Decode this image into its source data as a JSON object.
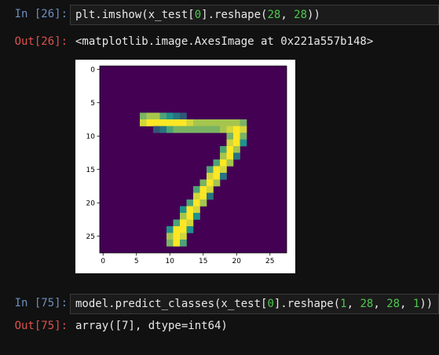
{
  "cells": [
    {
      "in_prompt": "In [26]:",
      "code": {
        "a": "plt.imshow(x_test[",
        "n1": "0",
        "b": "].reshape(",
        "n2": "28",
        "c": ", ",
        "n3": "28",
        "d": "))"
      },
      "out_prompt": "Out[26]:",
      "output": "<matplotlib.image.AxesImage at 0x221a557b148>"
    },
    {
      "in_prompt": "In [75]:",
      "code": {
        "a": "model.predict_classes(x_test[",
        "n1": "0",
        "b": "].reshape(",
        "n2": "1",
        "c": ", ",
        "n3": "28",
        "d": ", ",
        "n4": "28",
        "e": ", ",
        "n5": "1",
        "f": "))"
      },
      "out_prompt": "Out[75]:",
      "output": "array([7], dtype=int64)"
    }
  ],
  "chart_data": {
    "type": "heatmap",
    "colormap": "viridis",
    "colors": {
      "low": "#440154",
      "mid": "#21918c",
      "high": "#fde725"
    },
    "rows": 28,
    "cols": 28,
    "xticks": [
      "0",
      "5",
      "10",
      "15",
      "20",
      "25"
    ],
    "yticks": [
      "0",
      "5",
      "10",
      "15",
      "20",
      "25"
    ],
    "ink_cells": [
      [
        7,
        6,
        0.7
      ],
      [
        7,
        7,
        0.8
      ],
      [
        7,
        8,
        0.8
      ],
      [
        7,
        9,
        0.6
      ],
      [
        7,
        10,
        0.5
      ],
      [
        7,
        11,
        0.4
      ],
      [
        7,
        12,
        0.3
      ],
      [
        8,
        6,
        0.9
      ],
      [
        8,
        7,
        1
      ],
      [
        8,
        8,
        1
      ],
      [
        8,
        9,
        1
      ],
      [
        8,
        10,
        1
      ],
      [
        8,
        11,
        1
      ],
      [
        8,
        12,
        1
      ],
      [
        8,
        13,
        0.9
      ],
      [
        8,
        14,
        0.8
      ],
      [
        8,
        15,
        0.8
      ],
      [
        8,
        16,
        0.8
      ],
      [
        8,
        17,
        0.8
      ],
      [
        8,
        18,
        0.8
      ],
      [
        8,
        19,
        0.8
      ],
      [
        8,
        20,
        0.8
      ],
      [
        8,
        21,
        0.7
      ],
      [
        9,
        8,
        0.3
      ],
      [
        9,
        9,
        0.4
      ],
      [
        9,
        10,
        0.6
      ],
      [
        9,
        11,
        0.7
      ],
      [
        9,
        12,
        0.7
      ],
      [
        9,
        13,
        0.7
      ],
      [
        9,
        14,
        0.7
      ],
      [
        9,
        15,
        0.7
      ],
      [
        9,
        16,
        0.7
      ],
      [
        9,
        17,
        0.7
      ],
      [
        9,
        18,
        0.8
      ],
      [
        9,
        19,
        0.9
      ],
      [
        9,
        20,
        1
      ],
      [
        9,
        21,
        0.9
      ],
      [
        10,
        19,
        0.7
      ],
      [
        10,
        20,
        1
      ],
      [
        10,
        21,
        0.7
      ],
      [
        11,
        19,
        0.9
      ],
      [
        11,
        20,
        1
      ],
      [
        11,
        21,
        0.5
      ],
      [
        12,
        18,
        0.6
      ],
      [
        12,
        19,
        1
      ],
      [
        12,
        20,
        0.8
      ],
      [
        13,
        18,
        0.8
      ],
      [
        13,
        19,
        1
      ],
      [
        13,
        20,
        0.4
      ],
      [
        14,
        17,
        0.6
      ],
      [
        14,
        18,
        1
      ],
      [
        14,
        19,
        0.8
      ],
      [
        15,
        16,
        0.6
      ],
      [
        15,
        17,
        1
      ],
      [
        15,
        18,
        0.9
      ],
      [
        16,
        16,
        0.9
      ],
      [
        16,
        17,
        1
      ],
      [
        16,
        18,
        0.4
      ],
      [
        17,
        15,
        0.7
      ],
      [
        17,
        16,
        1
      ],
      [
        17,
        17,
        0.8
      ],
      [
        18,
        14,
        0.6
      ],
      [
        18,
        15,
        1
      ],
      [
        18,
        16,
        0.9
      ],
      [
        19,
        14,
        0.9
      ],
      [
        19,
        15,
        1
      ],
      [
        19,
        16,
        0.4
      ],
      [
        20,
        13,
        0.6
      ],
      [
        20,
        14,
        1
      ],
      [
        20,
        15,
        0.8
      ],
      [
        21,
        12,
        0.5
      ],
      [
        21,
        13,
        1
      ],
      [
        21,
        14,
        0.9
      ],
      [
        22,
        12,
        0.8
      ],
      [
        22,
        13,
        1
      ],
      [
        22,
        14,
        0.5
      ],
      [
        23,
        11,
        0.6
      ],
      [
        23,
        12,
        1
      ],
      [
        23,
        13,
        0.9
      ],
      [
        24,
        10,
        0.5
      ],
      [
        24,
        11,
        1
      ],
      [
        24,
        12,
        1
      ],
      [
        24,
        13,
        0.5
      ],
      [
        25,
        10,
        0.8
      ],
      [
        25,
        11,
        1
      ],
      [
        25,
        12,
        0.9
      ],
      [
        26,
        10,
        0.7
      ],
      [
        26,
        11,
        1
      ],
      [
        26,
        12,
        0.6
      ]
    ]
  }
}
